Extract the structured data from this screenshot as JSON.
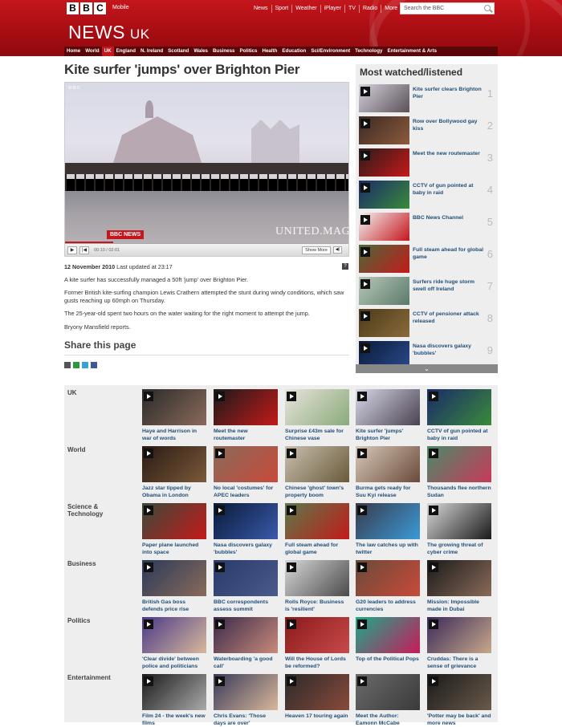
{
  "masthead": {
    "bbc_letters": [
      "B",
      "B",
      "C"
    ],
    "mobile": "Mobile",
    "links": [
      "News",
      "Sport",
      "Weather",
      "iPlayer",
      "TV",
      "Radio",
      "More"
    ],
    "search_placeholder": "Search the BBC",
    "news_title": "NEWS",
    "edition": "UK"
  },
  "nav": [
    "Home",
    "World",
    "UK",
    "England",
    "N. Ireland",
    "Scotland",
    "Wales",
    "Business",
    "Politics",
    "Health",
    "Education",
    "Sci/Environment",
    "Technology",
    "Entertainment & Arts"
  ],
  "nav_active": "UK",
  "article": {
    "headline": "Kite surfer 'jumps' over Brighton Pier",
    "video": {
      "watermark": "BBC",
      "channel": "BBC NEWS",
      "overlay": "UNITED.MAGI",
      "time": "00:10 / 02:01",
      "show_more": "Show More"
    },
    "date": "12 November 2010",
    "updated": "Last updated at 23:17",
    "paragraphs": [
      "A kite surfer has successfully managed a 50ft 'jump' over Brighton Pier.",
      "Former British kite-surfing champion Lewis Crathern attempted the stunt during windy conditions, which saw gusts reaching up 60mph on Thursday.",
      "The 25-year-old spent two hours on the water waiting for the right moment to attempt the jump.",
      "Bryony Mansfield reports."
    ],
    "share_title": "Share this page"
  },
  "most_watched": {
    "title": "Most watched/listened",
    "items": [
      {
        "label": "Kite surfer clears Brighton Pier",
        "rank": "1",
        "color1": "#d4d2dc",
        "color2": "#5a5058"
      },
      {
        "label": "Row over Bollywood gay kiss",
        "rank": "2",
        "color1": "#3b2a24",
        "color2": "#8b5a3c"
      },
      {
        "label": "Meet the new routemaster",
        "rank": "3",
        "color1": "#2a1a1a",
        "color2": "#c41a1a"
      },
      {
        "label": "CCTV of gun pointed at baby in raid",
        "rank": "4",
        "color1": "#1a2a6a",
        "color2": "#3a8a3a"
      },
      {
        "label": "BBC News Channel",
        "rank": "5",
        "color1": "#f4f4f4",
        "color2": "#c4161c"
      },
      {
        "label": "Full steam ahead for global game",
        "rank": "6",
        "color1": "#4a6a3a",
        "color2": "#c41a1a"
      },
      {
        "label": "Surfers ride huge storm swell off Ireland",
        "rank": "7",
        "color1": "#b8c8b8",
        "color2": "#5a7a6a"
      },
      {
        "label": "CCTV of pensioner attack released",
        "rank": "8",
        "color1": "#4a3a1a",
        "color2": "#8a6a3a"
      },
      {
        "label": "Nasa discovers galaxy 'bubbles'",
        "rank": "9",
        "color1": "#0a1a3a",
        "color2": "#2a4a8a"
      }
    ]
  },
  "categories": [
    {
      "name": "UK",
      "items": [
        {
          "label": "Haye and Harrison in war of words",
          "c1": "#2a2a2a",
          "c2": "#8a6a5a",
          "play": true
        },
        {
          "label": "Meet the new routemaster",
          "c1": "#1a1a1a",
          "c2": "#c41a1a",
          "play": true
        },
        {
          "label": "Surprise £43m sale for Chinese vase",
          "c1": "#e8e4dc",
          "c2": "#8aaa7a",
          "play": true
        },
        {
          "label": "Kite surfer 'jumps' Brighton Pier",
          "c1": "#d8d8e8",
          "c2": "#4a4250",
          "play": true
        },
        {
          "label": "CCTV of gun pointed at baby in raid",
          "c1": "#1a2a6a",
          "c2": "#3a8a3a",
          "play": true
        }
      ]
    },
    {
      "name": "World",
      "items": [
        {
          "label": "Jazz star tipped by Obama in London",
          "c1": "#2a1a14",
          "c2": "#7a5a3a",
          "play": true
        },
        {
          "label": "No local 'costumes' for APEC leaders",
          "c1": "#8a6a5a",
          "c2": "#c84a3a",
          "play": true
        },
        {
          "label": "Chinese 'ghost' town's property boom",
          "c1": "#c8c0b0",
          "c2": "#6a5a3a",
          "play": true
        },
        {
          "label": "Burma gets ready for Suu Kyi release",
          "c1": "#d8c8b8",
          "c2": "#6a4a3a",
          "play": true
        },
        {
          "label": "Thousands flee northern Sudan",
          "c1": "#4a8a6a",
          "c2": "#c83a5a",
          "play": true
        }
      ]
    },
    {
      "name": "Science & Technology",
      "items": [
        {
          "label": "Paper plane launched into space",
          "c1": "#3a4a3a",
          "c2": "#c41a1a",
          "play": true
        },
        {
          "label": "Nasa discovers galaxy 'bubbles'",
          "c1": "#0a1a3a",
          "c2": "#3a5aaa",
          "play": false
        },
        {
          "label": "Full steam ahead for global game",
          "c1": "#5a7a4a",
          "c2": "#c41a1a",
          "play": true
        },
        {
          "label": "The law catches up with twitter",
          "c1": "#3a3a4a",
          "c2": "#3a9ad8",
          "play": true
        },
        {
          "label": "The growing threat of cyber crime",
          "c1": "#d8d8d8",
          "c2": "#1a1a1a",
          "play": true
        }
      ]
    },
    {
      "name": "Business",
      "items": [
        {
          "label": "British Gas boss defends price rise",
          "c1": "#2a3a5a",
          "c2": "#8a6a5a",
          "play": true
        },
        {
          "label": "BBC correspondents assess summit",
          "c1": "#2a3a6a",
          "c2": "#4a5a8a",
          "play": true
        },
        {
          "label": "Rolls Royce: Business is 'resilient'",
          "c1": "#d8d8d8",
          "c2": "#4a4a4a",
          "play": true
        },
        {
          "label": "G20 leaders to address currencies",
          "c1": "#6a4a3a",
          "c2": "#c84a3a",
          "play": true
        },
        {
          "label": "Mission: Impossible made in Dubai",
          "c1": "#1a1a1a",
          "c2": "#8a6a5a",
          "play": true
        }
      ]
    },
    {
      "name": "Politics",
      "items": [
        {
          "label": "'Clear divide' between police and politicians",
          "c1": "#4a3a8a",
          "c2": "#d8b89a",
          "play": true
        },
        {
          "label": "Waterboarding 'a good call'",
          "c1": "#3a2a4a",
          "c2": "#c88a7a",
          "play": true
        },
        {
          "label": "Will the House of Lords be reformed?",
          "c1": "#8a1a1a",
          "c2": "#c84a4a",
          "play": true
        },
        {
          "label": "Top of the Political Pops",
          "c1": "#1aaa8a",
          "c2": "#c81a5a",
          "play": true
        },
        {
          "label": "Cruddas: There is a sense of grievance",
          "c1": "#3a2a5a",
          "c2": "#c8a88a",
          "play": true
        }
      ]
    },
    {
      "name": "Entertainment",
      "items": [
        {
          "label": "Film 24 - the week's new films",
          "c1": "#1a1a1a",
          "c2": "#aaaaaa",
          "play": true
        },
        {
          "label": "Chris Evans: 'Those days are over'",
          "c1": "#3a3a5a",
          "c2": "#d8b89a",
          "play": true
        },
        {
          "label": "Heaven 17 touring again",
          "c1": "#2a2a2a",
          "c2": "#8a4a3a",
          "play": true
        },
        {
          "label": "Meet the Author: Eamonn McCabe",
          "c1": "#6a6a6a",
          "c2": "#3a3a3a",
          "play": false
        },
        {
          "label": "'Potter may be back' and more news",
          "c1": "#1a1a1a",
          "c2": "#6a5a4a",
          "play": true
        }
      ]
    }
  ]
}
